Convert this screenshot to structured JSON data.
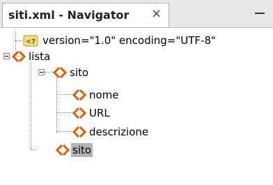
{
  "tab": {
    "title": "siti.xml - Navigator",
    "close_glyph": "×",
    "minimize_icon": "minimize-icon"
  },
  "colors": {
    "element_icon_orange": "#e8892c",
    "element_icon_red": "#c43b1a",
    "pi_icon_yellow": "#f2e27a",
    "pi_icon_border": "#b0952a",
    "selection": "#b4b4b4"
  },
  "tree": {
    "declaration": "version=\"1.0\" encoding=\"UTF-8\"",
    "root": "lista",
    "sito_expanded": "sito",
    "children": [
      "nome",
      "URL",
      "descrizione"
    ],
    "sito_collapsed": "sito"
  }
}
